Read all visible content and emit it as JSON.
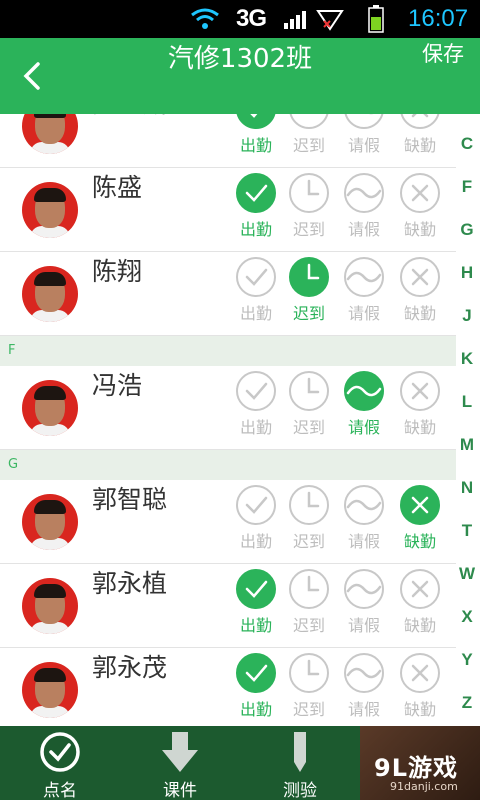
{
  "status_bar": {
    "network": "3G",
    "time": "16:07"
  },
  "header": {
    "back_icon": "back-arrow-icon",
    "title": "汽修1302班",
    "save_label": "保存"
  },
  "attendance_labels": [
    "出勤",
    "迟到",
    "请假",
    "缺勤"
  ],
  "sections": [
    "F",
    "G"
  ],
  "students": [
    {
      "name": "陈少威",
      "status": "出勤"
    },
    {
      "name": "陈盛",
      "status": "出勤"
    },
    {
      "name": "陈翔",
      "status": "迟到"
    },
    {
      "name": "冯浩",
      "status": "请假"
    },
    {
      "name": "郭智聪",
      "status": "缺勤"
    },
    {
      "name": "郭永植",
      "status": "出勤"
    },
    {
      "name": "郭永茂",
      "status": "出勤"
    }
  ],
  "index_letters": [
    "C",
    "F",
    "G",
    "H",
    "J",
    "K",
    "L",
    "M",
    "N",
    "T",
    "W",
    "X",
    "Y",
    "Z"
  ],
  "bottom_nav": [
    {
      "label": "点名",
      "icon": "checkmark-circle-icon",
      "active": true
    },
    {
      "label": "课件",
      "icon": "download-arrow-icon",
      "active": false
    },
    {
      "label": "测验",
      "icon": "pencil-icon",
      "active": false
    }
  ],
  "watermark": {
    "main": "9L游戏",
    "sub": "91danji.com"
  },
  "colors": {
    "accent": "#2bb35a",
    "nav_bg": "#1c5a2f",
    "inactive": "#bdbdbd"
  }
}
